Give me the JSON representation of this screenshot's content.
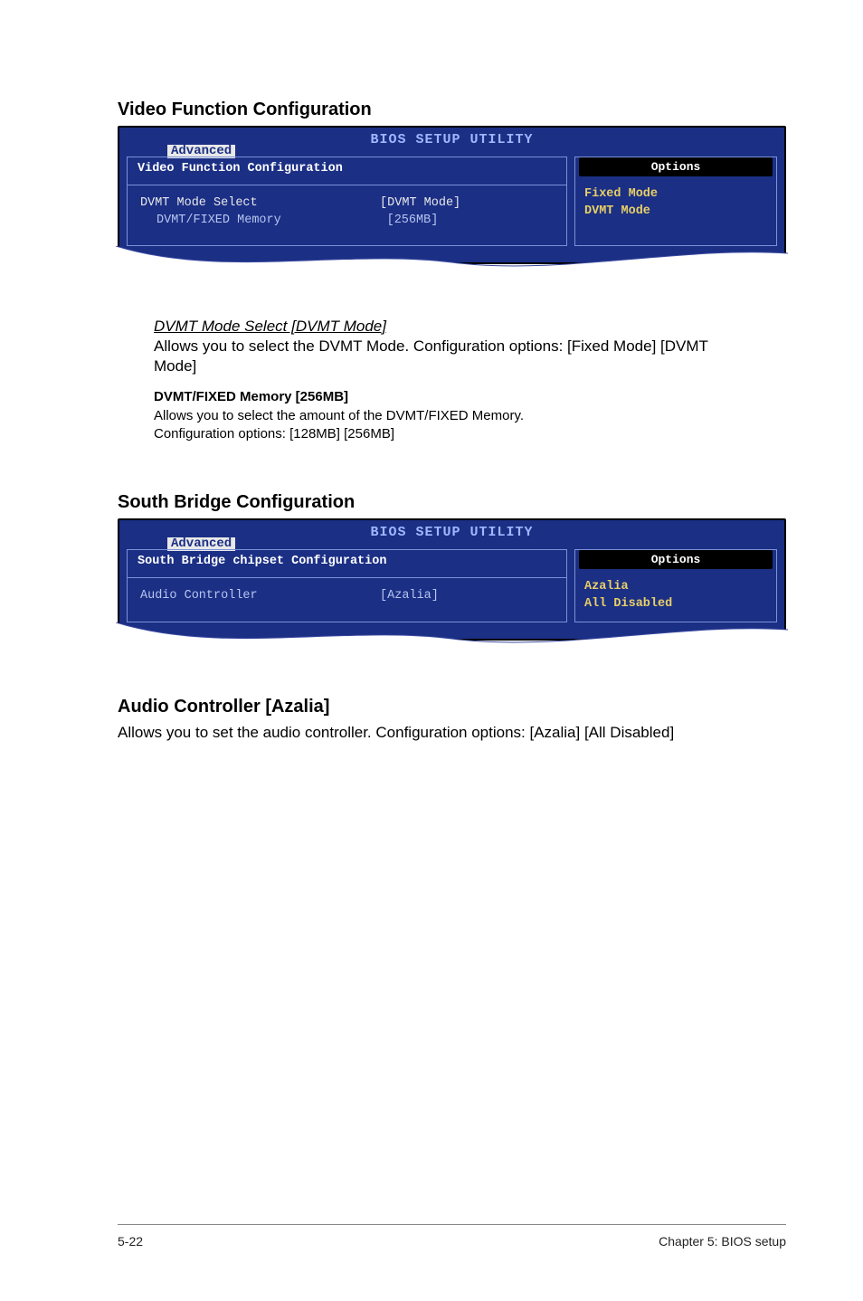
{
  "sections": {
    "video": {
      "heading": "Video Function Configuration",
      "bios": {
        "title": "BIOS SETUP UTILITY",
        "tab": "Advanced",
        "panel_title": "Video Function Configuration",
        "rows": [
          {
            "label": "DVMT Mode Select",
            "value": "[DVMT Mode]",
            "indent": false,
            "white": true
          },
          {
            "label": "DVMT/FIXED Memory",
            "value": "[256MB]",
            "indent": true,
            "white": false
          }
        ],
        "options_title": "Options",
        "options": [
          "Fixed Mode",
          "DVMT Mode"
        ]
      },
      "desc": {
        "title": "DVMT Mode Select [DVMT Mode]",
        "body": "Allows you to select the DVMT Mode. Configuration options: [Fixed Mode] [DVMT Mode]"
      },
      "subdesc": {
        "title": "DVMT/FIXED Memory [256MB]",
        "body1": "Allows you to select the amount of the DVMT/FIXED Memory.",
        "body2": "Configuration options: [128MB] [256MB]"
      }
    },
    "south": {
      "heading": "South Bridge Configuration",
      "bios": {
        "title": "BIOS SETUP UTILITY",
        "tab": "Advanced",
        "panel_title": "South Bridge chipset Configuration",
        "rows": [
          {
            "label": "Audio Controller",
            "value": "[Azalia]",
            "indent": false,
            "white": false
          }
        ],
        "options_title": "Options",
        "options": [
          "Azalia",
          "All Disabled"
        ]
      }
    },
    "audio": {
      "heading": "Audio Controller [Azalia]",
      "body": "Allows you to set the audio controller. Configuration options: [Azalia] [All Disabled]"
    }
  },
  "footer": {
    "left": "5-22",
    "right": "Chapter 5: BIOS setup"
  }
}
